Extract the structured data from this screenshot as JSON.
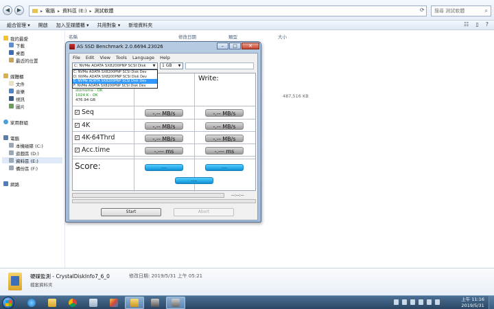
{
  "explorer": {
    "breadcrumb": [
      "電腦",
      "資料區 (E:)",
      "測試軟體"
    ],
    "search_placeholder": "搜尋 測試軟體",
    "toolbar": {
      "organize": "組合管理 ▾",
      "open": "開啟",
      "add_to_library": "加入至媒體櫃 ▾",
      "share_with": "共用對象 ▾",
      "new_folder": "新增資料夾"
    },
    "sidebar": {
      "favorites": "我的最愛",
      "downloads": "下載",
      "desktop": "桌面",
      "recent": "最近的位置",
      "libraries": "媒體櫃",
      "documents": "文件",
      "music": "音樂",
      "videos": "視訊",
      "pictures": "圖片",
      "homegroup": "家用群組",
      "computer": "電腦",
      "drive_c": "本機磁碟 (C:)",
      "drive_d": "遊戲區 (D:)",
      "drive_e": "資料區 (E:)",
      "drive_f": "備份區 (F:)",
      "network": "網路"
    },
    "columns": {
      "name": "名稱",
      "modified": "修改日期",
      "type": "類型",
      "size": "大小"
    },
    "size_value": "487,516 KB",
    "details": {
      "name": "硬碟監測 - CrystalDiskInfo7_6_0",
      "modified_label": "修改日期: 2019/5/31 上午 05:21",
      "type": "檔案資料夾"
    }
  },
  "asssd": {
    "title": "AS SSD Benchmark 2.0.6694.23026",
    "menu": [
      "File",
      "Edit",
      "View",
      "Tools",
      "Language",
      "Help"
    ],
    "drive_selected": "C: NVMe ADATA SX8200PNP SCSI Disk",
    "size_selected": "1 GB",
    "drive_options": [
      "C: NVMe ADATA SX8200PNP SCSI Disk Dev",
      "D: NVMe ADATA SX8200PNP SCSI Disk Dev",
      "E: NVMe ADATA SX8200PNP SCSI Disk Dev",
      "F: NVMe ADATA SX8200PNP SCSI Disk Dev"
    ],
    "highlighted_option_index": 2,
    "info": {
      "driver": "stornvme - OK",
      "align": "1024 K - OK",
      "capacity": "476.94 GB"
    },
    "write_header": "Write:",
    "rows": [
      {
        "label": "Seq",
        "read": "-.-- MB/s",
        "write": "-.-- MB/s"
      },
      {
        "label": "4K",
        "read": "-.-- MB/s",
        "write": "-.-- MB/s"
      },
      {
        "label": "4K-64Thrd",
        "read": "-.-- MB/s",
        "write": "-.-- MB/s"
      },
      {
        "label": "Acc.time",
        "read": "-.--- ms",
        "write": "-.--- ms"
      }
    ],
    "score_label": "Score:",
    "score_read": "----",
    "score_write": "----",
    "score_total": "----",
    "timer": "--:--:--",
    "start_label": "Start",
    "abort_label": "Abort"
  },
  "taskbar": {
    "time": "上午 11:16",
    "date": "2019/5/31"
  }
}
